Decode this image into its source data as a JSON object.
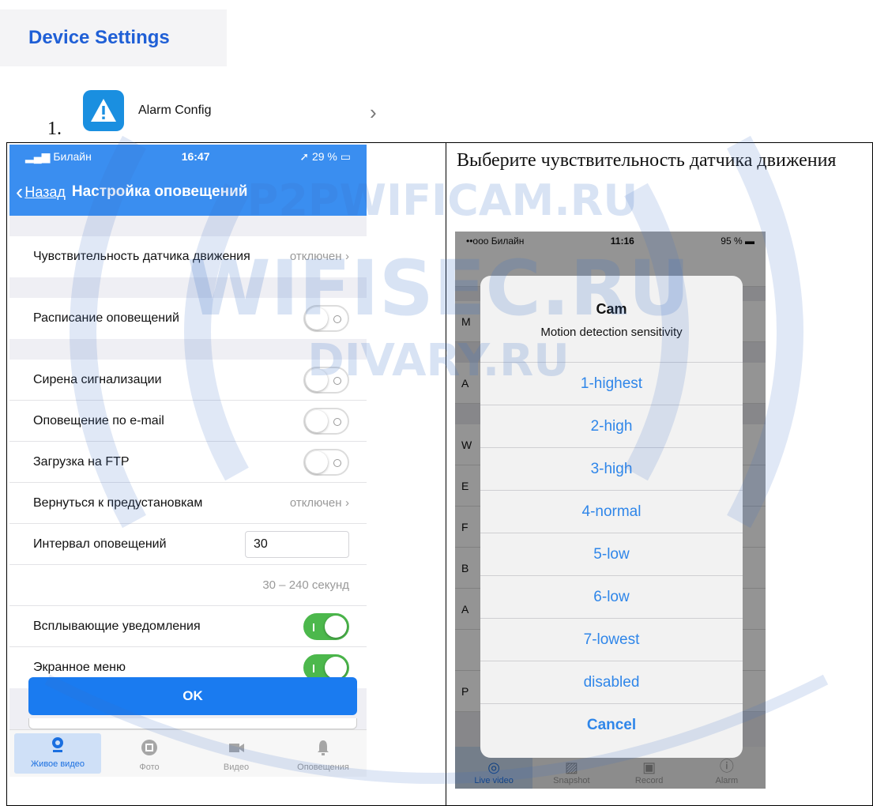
{
  "header": {
    "title": "Device Settings"
  },
  "alarm_item": {
    "number": "1.",
    "label": "Alarm Config",
    "chevron": "›"
  },
  "left_phone": {
    "status": {
      "carrier": "Билайн",
      "time": "16:47",
      "battery": "29 %"
    },
    "nav": {
      "back": "Назад",
      "title": "Настройка оповещений"
    },
    "rows": {
      "sensitivity": {
        "label": "Чувствительность датчика движения",
        "value": "отключен"
      },
      "schedule": {
        "label": "Расписание оповещений"
      },
      "siren": {
        "label": "Сирена сигнализации"
      },
      "email": {
        "label": "Оповещение по e-mail"
      },
      "ftp": {
        "label": "Загрузка на FTP"
      },
      "preset": {
        "label": "Вернуться к предустановкам",
        "value": "отключен"
      },
      "interval": {
        "label": "Интервал оповещений",
        "value": "30"
      },
      "interval_hint": {
        "label": "30 – 240 секунд"
      },
      "push": {
        "label": "Всплывающие  уведомления"
      },
      "osd": {
        "label": "Экранное меню"
      }
    },
    "ok_label": "OK",
    "tabs": [
      "Живое видео",
      "Фото",
      "Видео",
      "Оповещения"
    ]
  },
  "instruction": "Выберите чувствительность датчика движения",
  "right_phone": {
    "status": {
      "carrier": "••ooo Билайн",
      "time": "11:16",
      "battery": "95 %"
    },
    "alert": {
      "title": "Cam",
      "subtitle": "Motion detection sensitivity",
      "options": [
        "1-highest",
        "2-high",
        "3-high",
        "4-normal",
        "5-low",
        "6-low",
        "7-lowest",
        "disabled"
      ],
      "cancel": "Cancel"
    },
    "tabs": [
      "Live video",
      "Snapshot",
      "Record",
      "Alarm"
    ]
  },
  "watermarks": [
    "P2PWIFICAM.RU",
    "WIFISEC.RU",
    "DIVARY.RU"
  ],
  "colors": {
    "accent": "#3a8ef0",
    "ios_blue": "#2f86e9",
    "toggle_on": "#4cb84c",
    "header_text": "#1f5fd6"
  }
}
